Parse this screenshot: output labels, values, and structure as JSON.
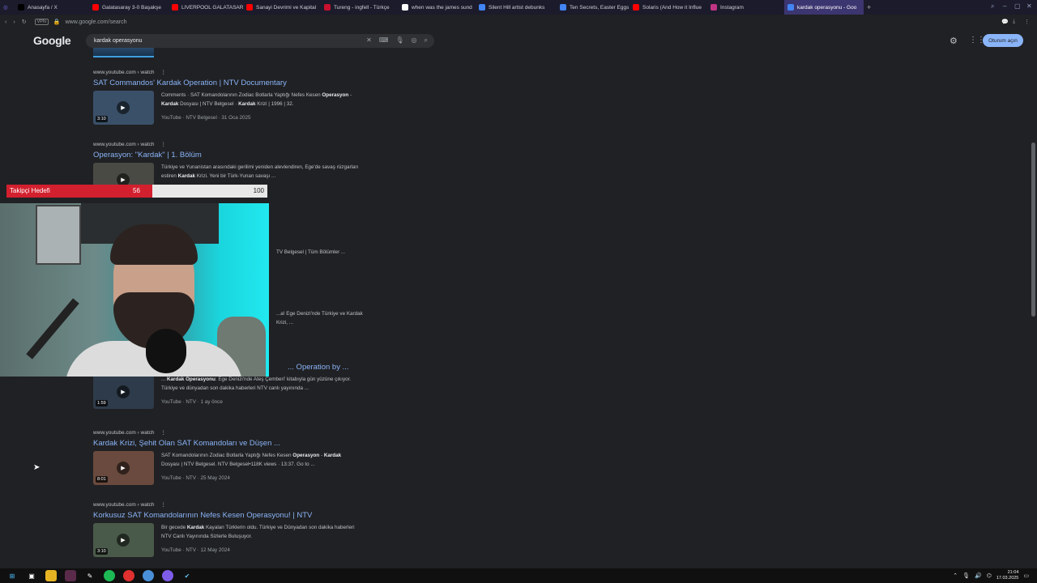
{
  "browser": {
    "tabs": [
      {
        "label": "Anasayfa / X",
        "color": "#000000"
      },
      {
        "label": "Galatasaray 3-0 Başakşe",
        "color": "#ff0000"
      },
      {
        "label": "LIVERPOOL GALATASARA",
        "color": "#ff0000"
      },
      {
        "label": "Sanayi Devrimi ve Kapital",
        "color": "#ff0000"
      },
      {
        "label": "Tureng - ingfell - Türkçe",
        "color": "#c8102e"
      },
      {
        "label": "when was the james sund",
        "color": "#ffffff"
      },
      {
        "label": "Silent Hill artist debunks",
        "color": "#4285f4"
      },
      {
        "label": "Ten Secrets, Easter Eggs",
        "color": "#4285f4"
      },
      {
        "label": "Solaris (And How it Influe",
        "color": "#ff0000"
      },
      {
        "label": "Instagram",
        "color": "#c13584"
      },
      {
        "label": "kardak operasyonu - Goo",
        "color": "#4285f4",
        "active": true
      }
    ],
    "vpn_label": "VPN",
    "url": "www.google.com/search"
  },
  "google": {
    "logo": "Google",
    "query": "kardak operasyonu",
    "signin_label": "Oturum açın"
  },
  "overlay": {
    "label": "Takipçi Hedefi",
    "current": 56,
    "max": 100,
    "fill_fraction": 0.56,
    "max_label": "100",
    "current_label": "56"
  },
  "results": [
    {
      "url": "www.youtube.com › watch",
      "title": "SAT Commandos' Kardak Operation | NTV Documentary",
      "snippet_html": "Comments · SAT Komandolarının Zodiac Botlarla Yaptığı Nefes Kesen <b>Operasyon</b> - <b>Kardak</b> Dosyası | NTV Belgesel · <b>Kardak</b> Krizi | 1996 | 32.",
      "meta": "YouTube · NTV Belgesel · 31 Oca 2025",
      "duration": "3:10",
      "thumb": "#3a5068"
    },
    {
      "url": "www.youtube.com › watch",
      "title": "Operasyon: \"Kardak\" | 1. Bölüm",
      "snippet_html": "Türkiye ve Yunanistan arasındaki gerilimi yeniden alevlendiren, Ege'de savaş rüzgarları estiren <b>Kardak</b> Krizi. Yeni bir Türk-Yunan savaşı ...",
      "meta": "",
      "duration": "",
      "thumb": "#4a4a44"
    },
    {
      "url": "",
      "title": "",
      "snippet_html": "TV Belgesel | Tüm Bölümler ...",
      "meta": "",
      "duration": "",
      "thumb": ""
    },
    {
      "url": "",
      "title": "",
      "snippet_html": "...a! Ege Denizi'nde Türkiye ve Kardak Krizi, ...",
      "meta": "",
      "duration": "",
      "thumb": ""
    },
    {
      "url": "",
      "title": "... Operation by ...",
      "snippet_html": "... <b>Kardak Operasyonu</b>: Ege Denizi'nde Ateş Çemberi' kitabıyla gün yüzüne çıkıyor. Türkiye ve dünyadan son dakika haberleri NTV canlı yayınında ...",
      "meta": "YouTube · NTV · 1 ay önce",
      "duration": "1:59",
      "thumb": "#2e3b4a"
    },
    {
      "url": "www.youtube.com › watch",
      "title": "Kardak Krizi, Şehit Olan SAT Komandoları ve Düşen ...",
      "snippet_html": "SAT Komandolarının Zodiac Botlarla Yaptığı Nefes Kesen <b>Operasyon</b> - <b>Kardak</b> Dosyası | NTV Belgesel. NTV Belgesel•118K views · 13:37. Go to ...",
      "meta": "YouTube · NTV · 25 May 2024",
      "duration": "8:01",
      "thumb": "#6a4a3e"
    },
    {
      "url": "www.youtube.com › watch",
      "title": "Korkusuz SAT Komandolarının Nefes Kesen Operasyonu! | NTV",
      "snippet_html": "Bir gecede <b>Kardak</b> Kayalan Türklerin oldu. Türkiye ve Dünyadan son dakika haberleri NTV Canlı Yayınında Sizlerle Buluşuyor.",
      "meta": "YouTube · NTV · 12 May 2024",
      "duration": "3:10",
      "thumb": "#4a5a4a"
    }
  ],
  "taskbar": {
    "time": "21:04",
    "date": "17.03.2025"
  }
}
